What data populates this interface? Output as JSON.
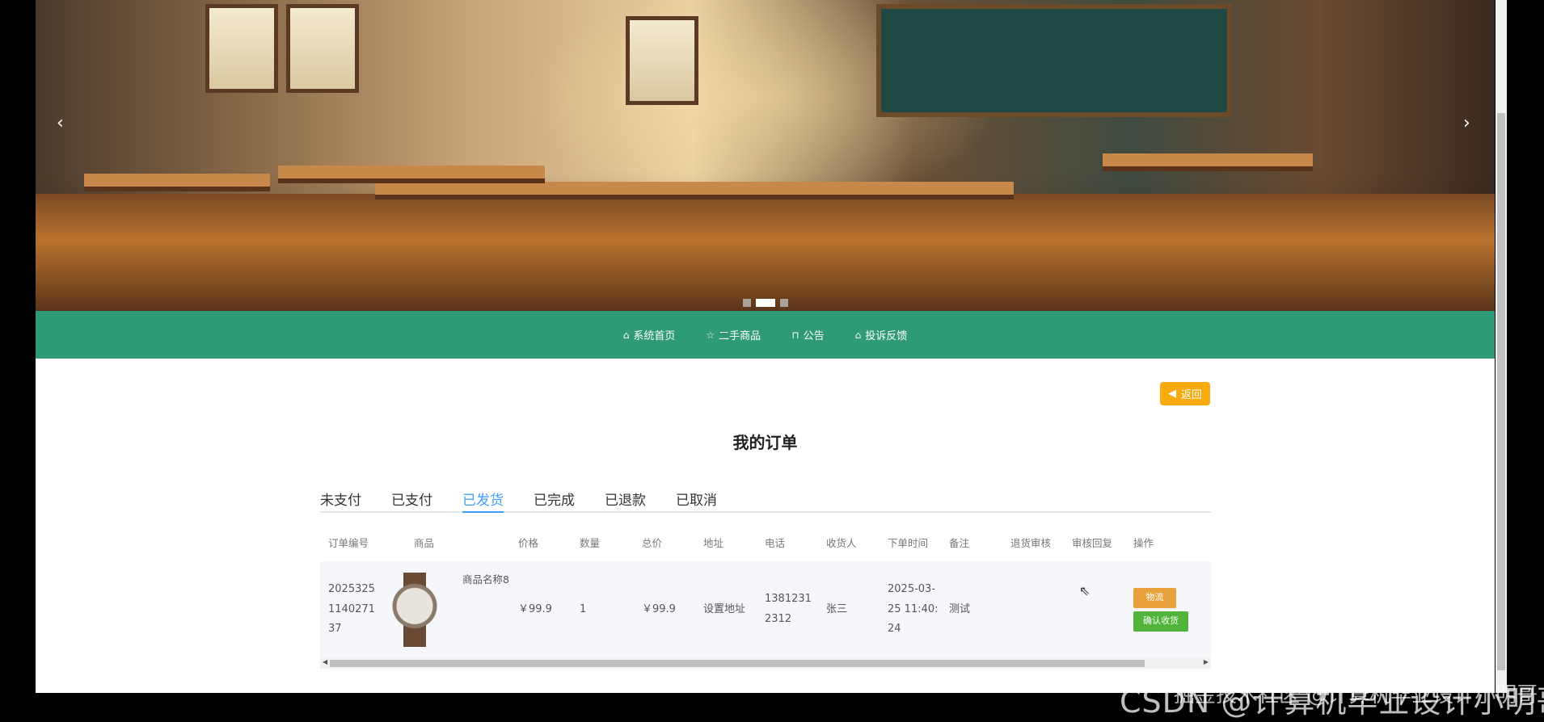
{
  "nav": {
    "items": [
      {
        "label": "系统首页",
        "icon": "home-icon"
      },
      {
        "label": "二手商品",
        "icon": "star-icon"
      },
      {
        "label": "公告",
        "icon": "bag-icon"
      },
      {
        "label": "投诉反馈",
        "icon": "home-icon"
      }
    ]
  },
  "back_label": "返回",
  "title": "我的订单",
  "tabs": [
    {
      "label": "未支付"
    },
    {
      "label": "已支付"
    },
    {
      "label": "已发货",
      "active": true
    },
    {
      "label": "已完成"
    },
    {
      "label": "已退款"
    },
    {
      "label": "已取消"
    }
  ],
  "table": {
    "headers": [
      "订单编号",
      "商品",
      "价格",
      "数量",
      "总价",
      "地址",
      "电话",
      "收货人",
      "下单时间",
      "备注",
      "退货审核",
      "审核回复",
      "操作"
    ],
    "rows": [
      {
        "order_no": "2025325114027137",
        "goods": "商品名称8",
        "price": "￥99.9",
        "qty": "1",
        "total": "￥99.9",
        "address": "设置地址",
        "phone": "13812312312",
        "receiver": "张三",
        "time": "2025-03-25 11:40:24",
        "remark": "测试",
        "return_review": "",
        "review_reply": "",
        "actions": [
          "物流",
          "确认收货"
        ]
      }
    ]
  },
  "carousel": {
    "slides": 3,
    "active": 2
  },
  "colors": {
    "nav": "#2f9a78",
    "back": "#f7ab0e",
    "tab_active": "#409eff",
    "btn_logistics": "#e9a23b",
    "btn_confirm": "#51b43a"
  },
  "watermark": {
    "csdn": "CSDN @计算机毕业设计小明哥",
    "juejin": "掘金技术社区 @计算机毕业设计小明哥"
  }
}
